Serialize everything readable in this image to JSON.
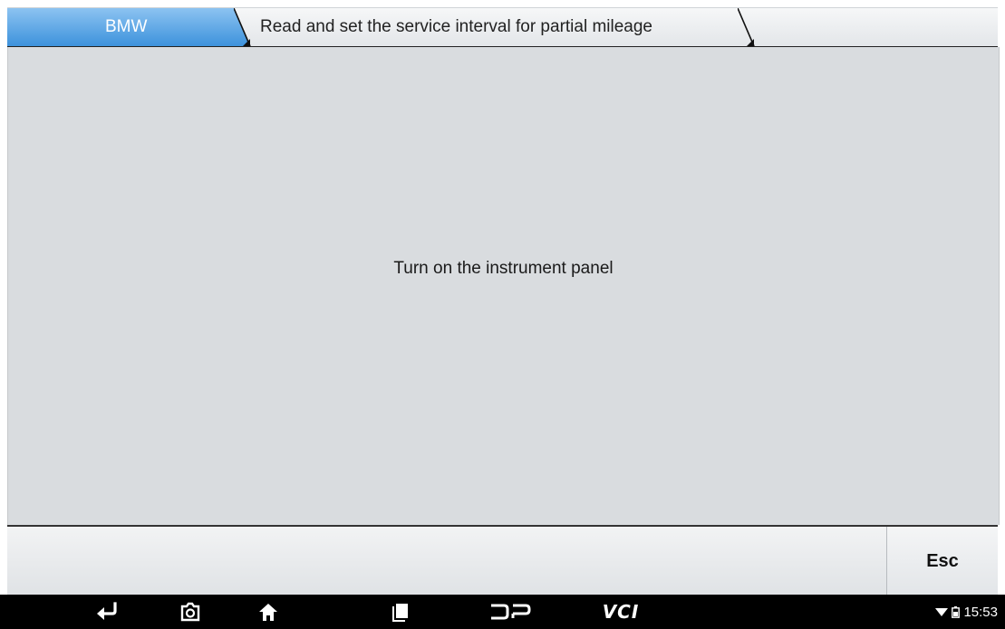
{
  "breadcrumb": {
    "items": [
      {
        "label": "BMW"
      },
      {
        "label": "Read and set the service interval for partial mileage"
      }
    ]
  },
  "main": {
    "message": "Turn on the instrument panel"
  },
  "actions": {
    "esc_label": "Esc"
  },
  "navbar": {
    "icons": [
      "back-icon",
      "screenshot-icon",
      "home-icon",
      "recent-apps-icon",
      "dp-icon",
      "vci-icon"
    ],
    "vci_label": "VCI",
    "status": {
      "icons": [
        "wifi-icon",
        "battery-icon"
      ],
      "time": "15:53"
    }
  },
  "colors": {
    "accent": "#3d92dc",
    "panel": "#d9dcdf",
    "navbar": "#000000"
  }
}
